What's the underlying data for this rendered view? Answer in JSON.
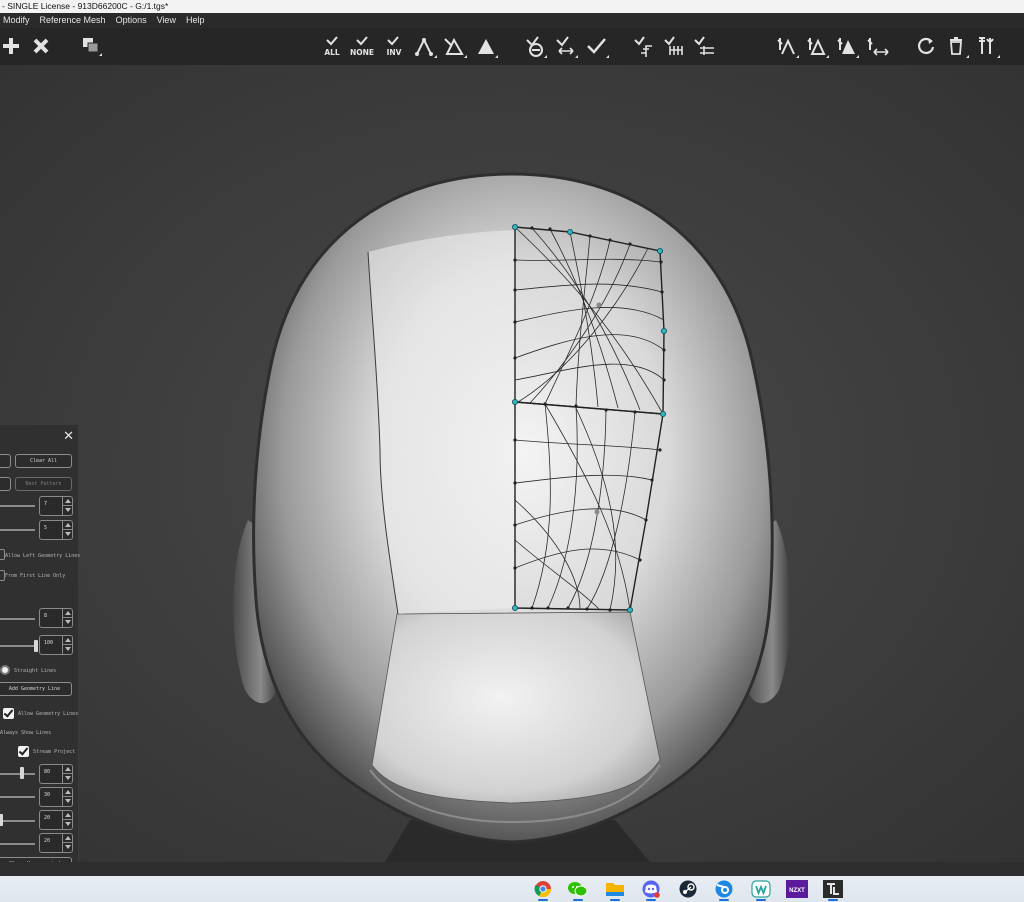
{
  "window": {
    "title": "- SINGLE License - 913D66200C - G:/1.tgs*"
  },
  "menu": {
    "items": [
      "Modify",
      "Reference Mesh",
      "Options",
      "View",
      "Help"
    ]
  },
  "toolbar": {
    "left_tools": [
      "add-icon",
      "delete-icon",
      "duplicate-icon"
    ],
    "selection": {
      "all": "ALL",
      "none": "NONE",
      "inv": "INV"
    },
    "groups": [
      "select-mode-icons",
      "edge-tools-icons",
      "strip-tools-icons",
      "relax-tools-icons",
      "refresh-icon",
      "trash-icon",
      "tools-icon"
    ]
  },
  "panel": {
    "clear_all": "Clear All",
    "next_pattern": "Next Pattern",
    "spin_a": "7",
    "spin_b": "5",
    "allow_left_geometry_lines": "Allow Left Geometry Lines",
    "from_first_line_only": "From First Line Only",
    "spin_c": "8",
    "spin_d": "100",
    "straight_lines": "Straight Lines",
    "add_geometry_line": "Add Geometry Line",
    "allow_geometry_lines": "Allow Geometry Lines",
    "always_show_lines": "Always Show Lines",
    "stream_project": "Stream Project",
    "spin_e": "80",
    "spin_f": "30",
    "spin_g": "20",
    "spin_h": "20",
    "clear_unconnected": "Clear Unconnected"
  },
  "taskbar": {
    "apps": [
      "chrome-icon",
      "wechat-icon",
      "file-explorer-icon",
      "discord-icon",
      "steam-icon",
      "blender-icon",
      "browser-icon",
      "nzxt-icon",
      "topogun-icon"
    ],
    "nzxt_label": "NZXT"
  },
  "colors": {
    "background": "#2b2b2b",
    "toolbar": "#262626",
    "panel": "#303030",
    "vertex_cyan": "#2fb6c0",
    "mesh_line": "#222222"
  }
}
